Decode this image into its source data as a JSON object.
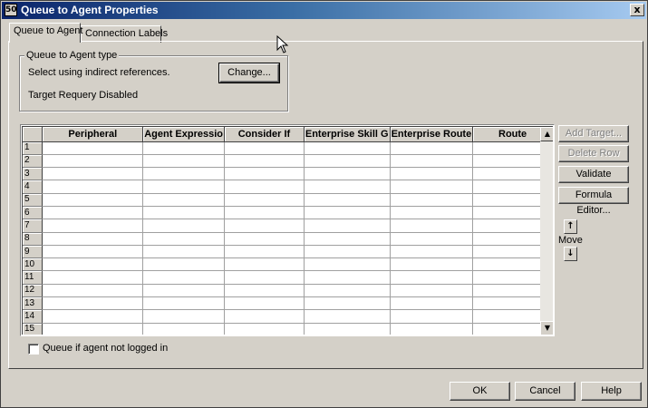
{
  "window": {
    "title": "Queue to Agent Properties",
    "icon_glyph": "50",
    "close_glyph": "x"
  },
  "tabs": [
    {
      "label": "Queue to Agent",
      "active": true
    },
    {
      "label": "Connection Labels",
      "active": false
    }
  ],
  "type_group": {
    "legend": "Queue to Agent type",
    "description": "Select using indirect references.",
    "change_button": "Change...",
    "requery_status": "Target Requery Disabled"
  },
  "grid": {
    "columns": [
      "Peripheral",
      "Agent Expressio",
      "Consider If",
      "Enterprise Skill G",
      "Enterprise Route",
      "Route"
    ],
    "row_numbers": [
      "1",
      "2",
      "3",
      "4",
      "5",
      "6",
      "7",
      "8",
      "9",
      "10",
      "11",
      "12",
      "13",
      "14",
      "15"
    ],
    "scroll_up_glyph": "▲",
    "scroll_down_glyph": "▼"
  },
  "side_buttons": {
    "add_target": "Add Target...",
    "delete_row": "Delete Row",
    "validate": "Validate",
    "formula_editor": "Formula Editor...",
    "move_label": "Move",
    "move_up_glyph": "↑",
    "move_down_glyph": "↓"
  },
  "queue_checkbox": {
    "label": "Queue if agent not logged in",
    "checked": false
  },
  "footer": {
    "ok": "OK",
    "cancel": "Cancel",
    "help": "Help"
  },
  "colors": {
    "face": "#d4d0c8",
    "title_start": "#0a246a",
    "title_end": "#a6caf0"
  }
}
